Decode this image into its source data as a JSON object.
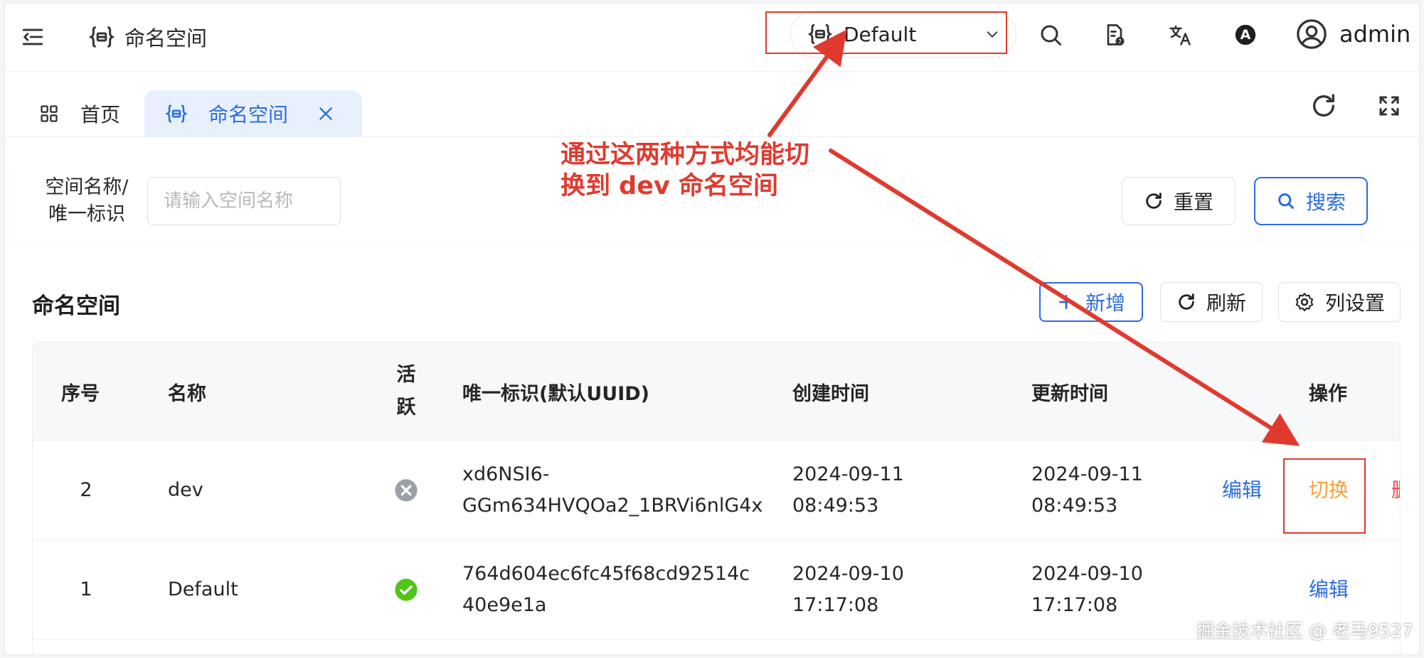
{
  "header": {
    "title": "命名空间",
    "namespace_selected": "Default",
    "username": "admin",
    "icons": [
      "menu-fold-icon",
      "namespace-icon",
      "chevron-down-icon",
      "search-icon",
      "document-help-icon",
      "translate-icon",
      "theme-icon",
      "user-avatar-icon"
    ],
    "theme_badge": "A"
  },
  "tabs": [
    {
      "label": "首页",
      "icon": "dashboard-icon",
      "active": false
    },
    {
      "label": "命名空间",
      "icon": "namespace-icon",
      "active": true,
      "closable": true
    }
  ],
  "search": {
    "label": "空间名称/唯一标识",
    "placeholder": "请输入空间名称",
    "reset_label": "重置",
    "search_label": "搜索"
  },
  "table_section": {
    "title": "命名空间",
    "add_label": "新增",
    "refresh_label": "刷新",
    "columns_label": "列设置",
    "columns": [
      "序号",
      "名称",
      "活跃",
      "唯一标识(默认UUID)",
      "创建时间",
      "更新时间",
      "操作"
    ],
    "rows": [
      {
        "index": "2",
        "name": "dev",
        "active": false,
        "uid_line1": "xd6NSI6-",
        "uid_line2": "GGm634HVQOa2_1BRVi6nlG4x",
        "created_date": "2024-09-11",
        "created_time": "08:49:53",
        "updated_date": "2024-09-11",
        "updated_time": "08:49:53",
        "action_edit": "编辑",
        "action_switch": "切换",
        "action_delete": "删"
      },
      {
        "index": "1",
        "name": "Default",
        "active": true,
        "uid_line1": "764d604ec6fc45f68cd92514c",
        "uid_line2": "40e9e1a",
        "created_date": "2024-09-10",
        "created_time": "17:17:08",
        "updated_date": "2024-09-10",
        "updated_time": "17:17:08",
        "action_edit": "编辑"
      }
    ]
  },
  "annotation": {
    "line1": "通过这两种方式均能切",
    "line2": "换到 dev 命名空间",
    "color": "#e03a2f"
  },
  "footer_watermark": "掘金技术社区 @ 老马9527",
  "colors": {
    "primary": "#2d6cdf",
    "switch": "#f2a33a",
    "danger": "#e5484d",
    "success": "#52c41a",
    "inactive": "#9aa0a6"
  }
}
